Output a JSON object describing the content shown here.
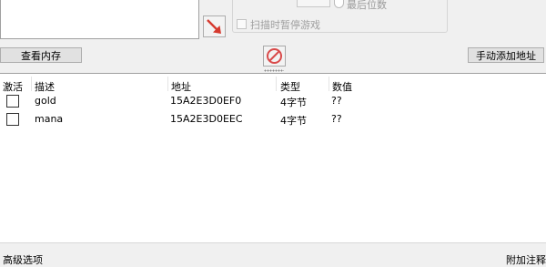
{
  "scan_panel": {
    "last_digit_label": "最后位数",
    "pause_scan_label": "扫描时暂停游戏"
  },
  "toolbar": {
    "view_memory_label": "查看内存",
    "manual_add_label": "手动添加地址"
  },
  "address_table": {
    "columns": [
      "激活",
      "描述",
      "地址",
      "类型",
      "数值"
    ],
    "rows": [
      {
        "active": false,
        "description": "gold",
        "address": "15A2E3D0EF0",
        "type": "4字节",
        "value": "??"
      },
      {
        "active": false,
        "description": "mana",
        "address": "15A2E3D0EEC",
        "type": "4字节",
        "value": "??"
      }
    ]
  },
  "status_bar": {
    "advanced_label": "高级选项",
    "comment_label": "附加注释"
  },
  "colors": {
    "arrow": "#d63a2f",
    "stop_icon": "#d94a4a"
  },
  "icons": {
    "add_to_list": "red-arrow-down-right",
    "stop": "no-entry-circle"
  }
}
